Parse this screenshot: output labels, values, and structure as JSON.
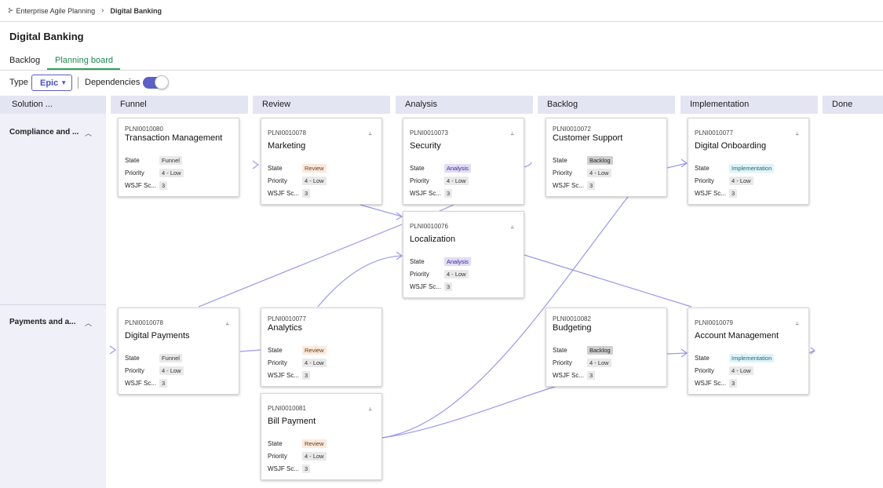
{
  "breadcrumb": {
    "parent": "Enterprise Agile Planning",
    "current": "Digital Banking",
    "parent_icon": "hierarchy-icon"
  },
  "page_title": "Digital Banking",
  "tabs": [
    {
      "label": "Backlog"
    },
    {
      "label": "Planning board"
    }
  ],
  "toolbar": {
    "type_label": "Type",
    "type_value": "Epic",
    "dependencies_label": "Dependencies",
    "dependencies_enabled": true
  },
  "board": {
    "side_header": "Solution ...",
    "lanes": [
      {
        "label": "Compliance and ..."
      },
      {
        "label": "Payments and a..."
      }
    ],
    "columns": [
      {
        "label": "Funnel"
      },
      {
        "label": "Review"
      },
      {
        "label": "Analysis"
      },
      {
        "label": "Backlog"
      },
      {
        "label": "Implementation"
      },
      {
        "label": "Done"
      }
    ],
    "field_labels": {
      "state": "State",
      "priority": "Priority",
      "wsjf": "WSJF Sc..."
    },
    "cards": [
      {
        "id": "PLNI0010080",
        "name": "Transaction Management",
        "state": "Funnel",
        "priority": "4 - Low",
        "wsjf": "3"
      },
      {
        "id": "PLNI0010078",
        "name": "Marketing",
        "state": "Review",
        "priority": "4 - Low",
        "wsjf": "3",
        "dependency_icon": "dependency-icon"
      },
      {
        "id": "PLNI0010073",
        "name": "Security",
        "state": "Analysis",
        "priority": "4 - Low",
        "wsjf": "3",
        "dependency_icon": "dependency-icon"
      },
      {
        "id": "PLNI0010072",
        "name": "Customer Support",
        "state": "Backlog",
        "priority": "4 - Low",
        "wsjf": "3"
      },
      {
        "id": "PLNI0010077",
        "name": "Digital Onboarding",
        "state": "Implementation",
        "priority": "4 - Low",
        "wsjf": "3",
        "dependency_icon": "dependency-icon"
      },
      {
        "id": "PLNI0010076",
        "name": "Localization",
        "state": "Analysis",
        "priority": "4 - Low",
        "wsjf": "3",
        "dependency_icon": "dependency-icon"
      },
      {
        "id": "PLNI0010078",
        "name": "Digital Payments",
        "state": "Funnel",
        "priority": "4 - Low",
        "wsjf": "3",
        "dependency_icon": "dependency-icon"
      },
      {
        "id": "PLNI0010077",
        "name": "Analytics",
        "state": "Review",
        "priority": "4 - Low",
        "wsjf": "3"
      },
      {
        "id": "PLNI0010082",
        "name": "Budgeting",
        "state": "Backlog",
        "priority": "4 - Low",
        "wsjf": "3"
      },
      {
        "id": "PLNI0010079",
        "name": "Account Management",
        "state": "Implementation",
        "priority": "4 - Low",
        "wsjf": "3",
        "dependency_icon": "dependency-icon"
      },
      {
        "id": "PLNI0010081",
        "name": "Bill Payment",
        "state": "Review",
        "priority": "4 - Low",
        "wsjf": "3",
        "dependency_icon": "dependency-icon"
      }
    ]
  },
  "colors": {
    "accent": "#5b5fc7",
    "tab_active": "#1f8a4c",
    "dependency_line": "#9b98ee"
  }
}
